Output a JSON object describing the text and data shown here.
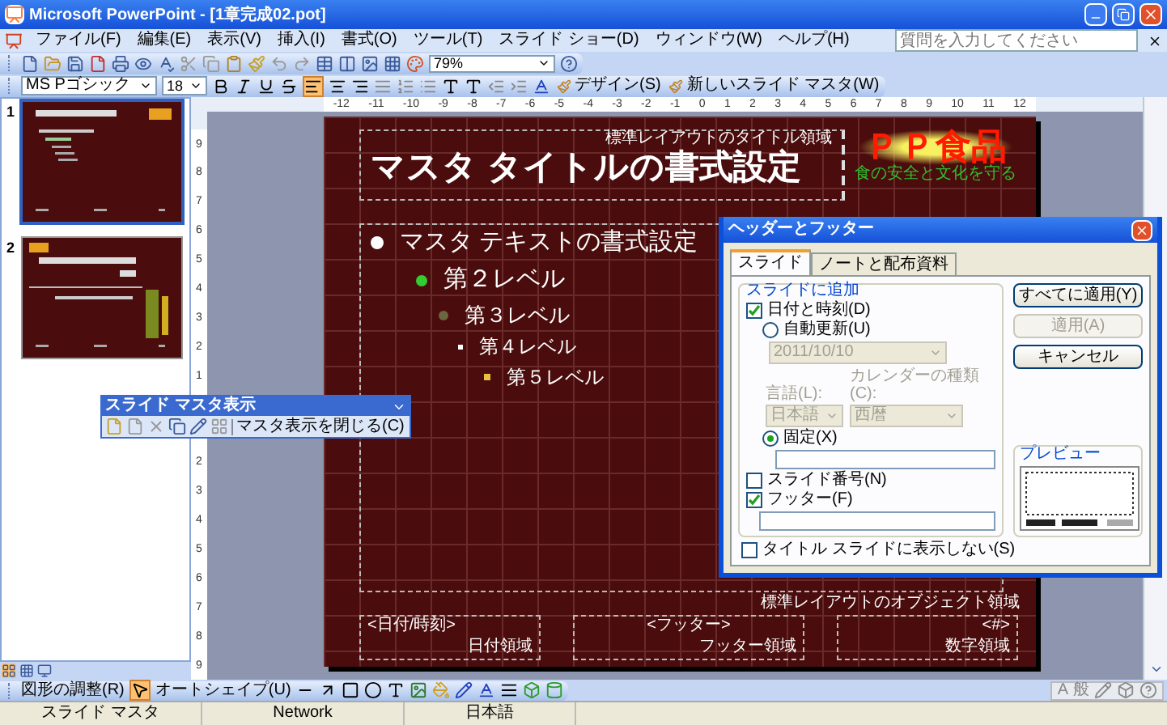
{
  "window": {
    "title": "Microsoft PowerPoint - [1章完成02.pot]"
  },
  "menu": [
    "ファイル(F)",
    "編集(E)",
    "表示(V)",
    "挿入(I)",
    "書式(O)",
    "ツール(T)",
    "スライド ショー(D)",
    "ウィンドウ(W)",
    "ヘルプ(H)"
  ],
  "help_search": {
    "placeholder": "質問を入力してください"
  },
  "standard_toolbar": {
    "zoom": "79%"
  },
  "formatting_toolbar": {
    "font": "MS Pゴシック",
    "size": "18",
    "buttons": [
      "デザイン(S)",
      "新しいスライド マスタ(W)"
    ]
  },
  "thumbnails": [
    {
      "number": "1",
      "selected": true
    },
    {
      "number": "2",
      "selected": false
    }
  ],
  "horizontal_ruler": [
    "-12",
    "-11",
    "-10",
    "-9",
    "-8",
    "-7",
    "-6",
    "-5",
    "-4",
    "-3",
    "-2",
    "-1",
    "0",
    "1",
    "2",
    "3",
    "4",
    "5",
    "6",
    "7",
    "8",
    "9",
    "10",
    "11",
    "12"
  ],
  "vertical_ruler": {
    "upper": [
      "9",
      "8",
      "7",
      "6",
      "5",
      "4",
      "3",
      "2",
      "1"
    ],
    "lower": [
      "2",
      "3",
      "4",
      "5",
      "6",
      "7",
      "8",
      "9"
    ]
  },
  "slide": {
    "title_label": "標準レイアウトのタイトル領域",
    "title": "マスタ タイトルの書式設定",
    "logo": {
      "name": "ＰＰ食品",
      "tagline": "食の安全と文化を守る"
    },
    "bullets": [
      {
        "text": "マスタ テキストの書式設定",
        "color": "#ffffff",
        "children": [
          {
            "text": "第２レベル",
            "color": "#33cc33",
            "children": [
              {
                "text": "第３レベル",
                "color": "#6b6640",
                "children": [
                  {
                    "text": "第４レベル",
                    "color": "#ffffff",
                    "children": [
                      {
                        "text": "第５レベル",
                        "color": "#e8c040"
                      }
                    ]
                  }
                ]
              }
            ]
          }
        ]
      }
    ],
    "object_label": "標準レイアウトのオブジェクト領域",
    "footer_areas": [
      {
        "placeholder_text": "<日付/時刻>",
        "label": "日付領域"
      },
      {
        "placeholder_text": "<フッター>",
        "label": "フッター領域"
      },
      {
        "placeholder_text": "<#>",
        "label": "数字領域"
      }
    ]
  },
  "master_toolbar": {
    "title": "スライド マスタ表示",
    "close_button": "マスタ表示を閉じる(C)"
  },
  "dialog": {
    "title": "ヘッダーとフッター",
    "tabs": [
      {
        "label": "スライド",
        "selected": true
      },
      {
        "label": "ノートと配布資料",
        "selected": false
      }
    ],
    "group_label": "スライドに追加",
    "date_time": {
      "label": "日付と時刻(D)",
      "checked": true
    },
    "date_modes": [
      {
        "label": "自動更新(U)",
        "selected": false
      },
      {
        "label": "固定(X)",
        "selected": true
      }
    ],
    "date_select": {
      "value": "2011/10/10",
      "disabled": true
    },
    "language": {
      "label": "言語(L):",
      "value": "日本語",
      "disabled": true
    },
    "calendar": {
      "label": "カレンダーの種類(C):",
      "value": "西暦",
      "disabled": true
    },
    "slide_number": {
      "label": "スライド番号(N)",
      "checked": false
    },
    "footer": {
      "label": "フッター(F)",
      "checked": true
    },
    "hide_on_title": {
      "label": "タイトル スライドに表示しない(S)",
      "checked": false
    },
    "buttons": [
      {
        "label": "すべてに適用(Y)",
        "disabled": false
      },
      {
        "label": "適用(A)",
        "disabled": true
      },
      {
        "label": "キャンセル",
        "disabled": false
      }
    ],
    "preview_label": "プレビュー"
  },
  "drawing_toolbar": {
    "draw_menu": "図形の調整(R)",
    "autoshapes": "オートシェイプ(U)"
  },
  "status_bar": [
    "スライド マスタ",
    "Network",
    "日本語"
  ],
  "language_bar": [
    "A",
    "般"
  ]
}
